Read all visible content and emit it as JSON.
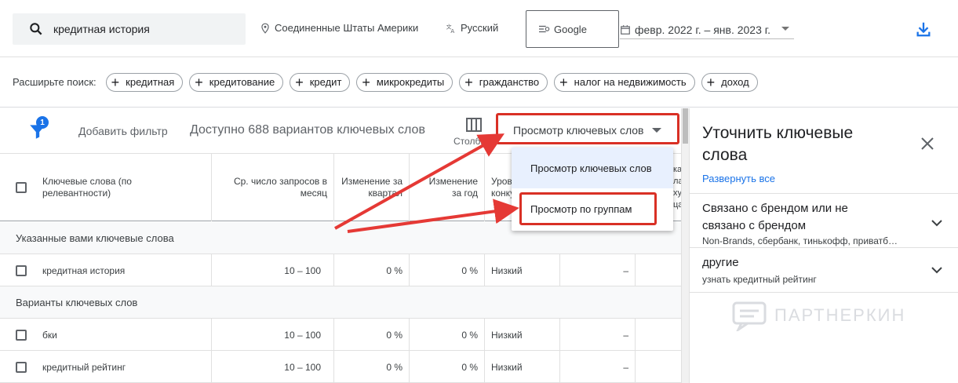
{
  "topbar": {
    "search_value": "кредитная история",
    "location": "Соединенные Штаты Америки",
    "language": "Русский",
    "engine": "Google",
    "date_range": "февр. 2022 г. – янв. 2023 г."
  },
  "expand_search": {
    "label": "Расширьте поиск:",
    "chips": [
      "кредитная",
      "кредитование",
      "кредит",
      "микрокредиты",
      "гражданство",
      "налог на недвижимость",
      "доход"
    ]
  },
  "toolbar": {
    "filter_badge": "1",
    "add_filter": "Добавить фильтр",
    "available": "Доступно 688 вариантов ключевых слов",
    "columns": "Столбцы",
    "view_button": "Просмотр ключевых слов"
  },
  "table": {
    "headers": {
      "keyword": "Ключевые слова (по релевантности)",
      "avg": "Ср. число запросов в месяц",
      "qchange": "Изменение за квартал",
      "ychange": "Изменение за год",
      "competition": "Уровень конкуренции",
      "h6": "",
      "h7": "",
      "h8": "ка ла ху ца"
    },
    "section1": "Указанные вами ключевые слова",
    "section2": "Варианты ключевых слов",
    "rows": [
      {
        "kw": "кредитная история",
        "avg": "10 – 100",
        "q": "0 %",
        "y": "0 %",
        "comp": "Низкий",
        "c6": "–"
      },
      {
        "kw": "бки",
        "avg": "10 – 100",
        "q": "0 %",
        "y": "0 %",
        "comp": "Низкий",
        "c6": "–"
      },
      {
        "kw": "кредитный рейтинг",
        "avg": "10 – 100",
        "q": "0 %",
        "y": "0 %",
        "comp": "Низкий",
        "c6": "–"
      }
    ]
  },
  "dropdown": {
    "items": [
      "Просмотр ключевых слов",
      "Просмотр по группам"
    ]
  },
  "panel": {
    "title": "Уточнить ключевые слова",
    "expand_all": "Развернуть все",
    "groups": [
      {
        "title": "Связано с брендом или не связано с брендом",
        "sub": "Non-Brands, сбербанк, тинькофф, приватб…"
      },
      {
        "title": "другие",
        "sub": "узнать кредитный рейтинг"
      }
    ],
    "watermark": "ПАРТНЕРКИН"
  },
  "colors": {
    "accent": "#1a73e8",
    "highlight": "#d93025"
  }
}
